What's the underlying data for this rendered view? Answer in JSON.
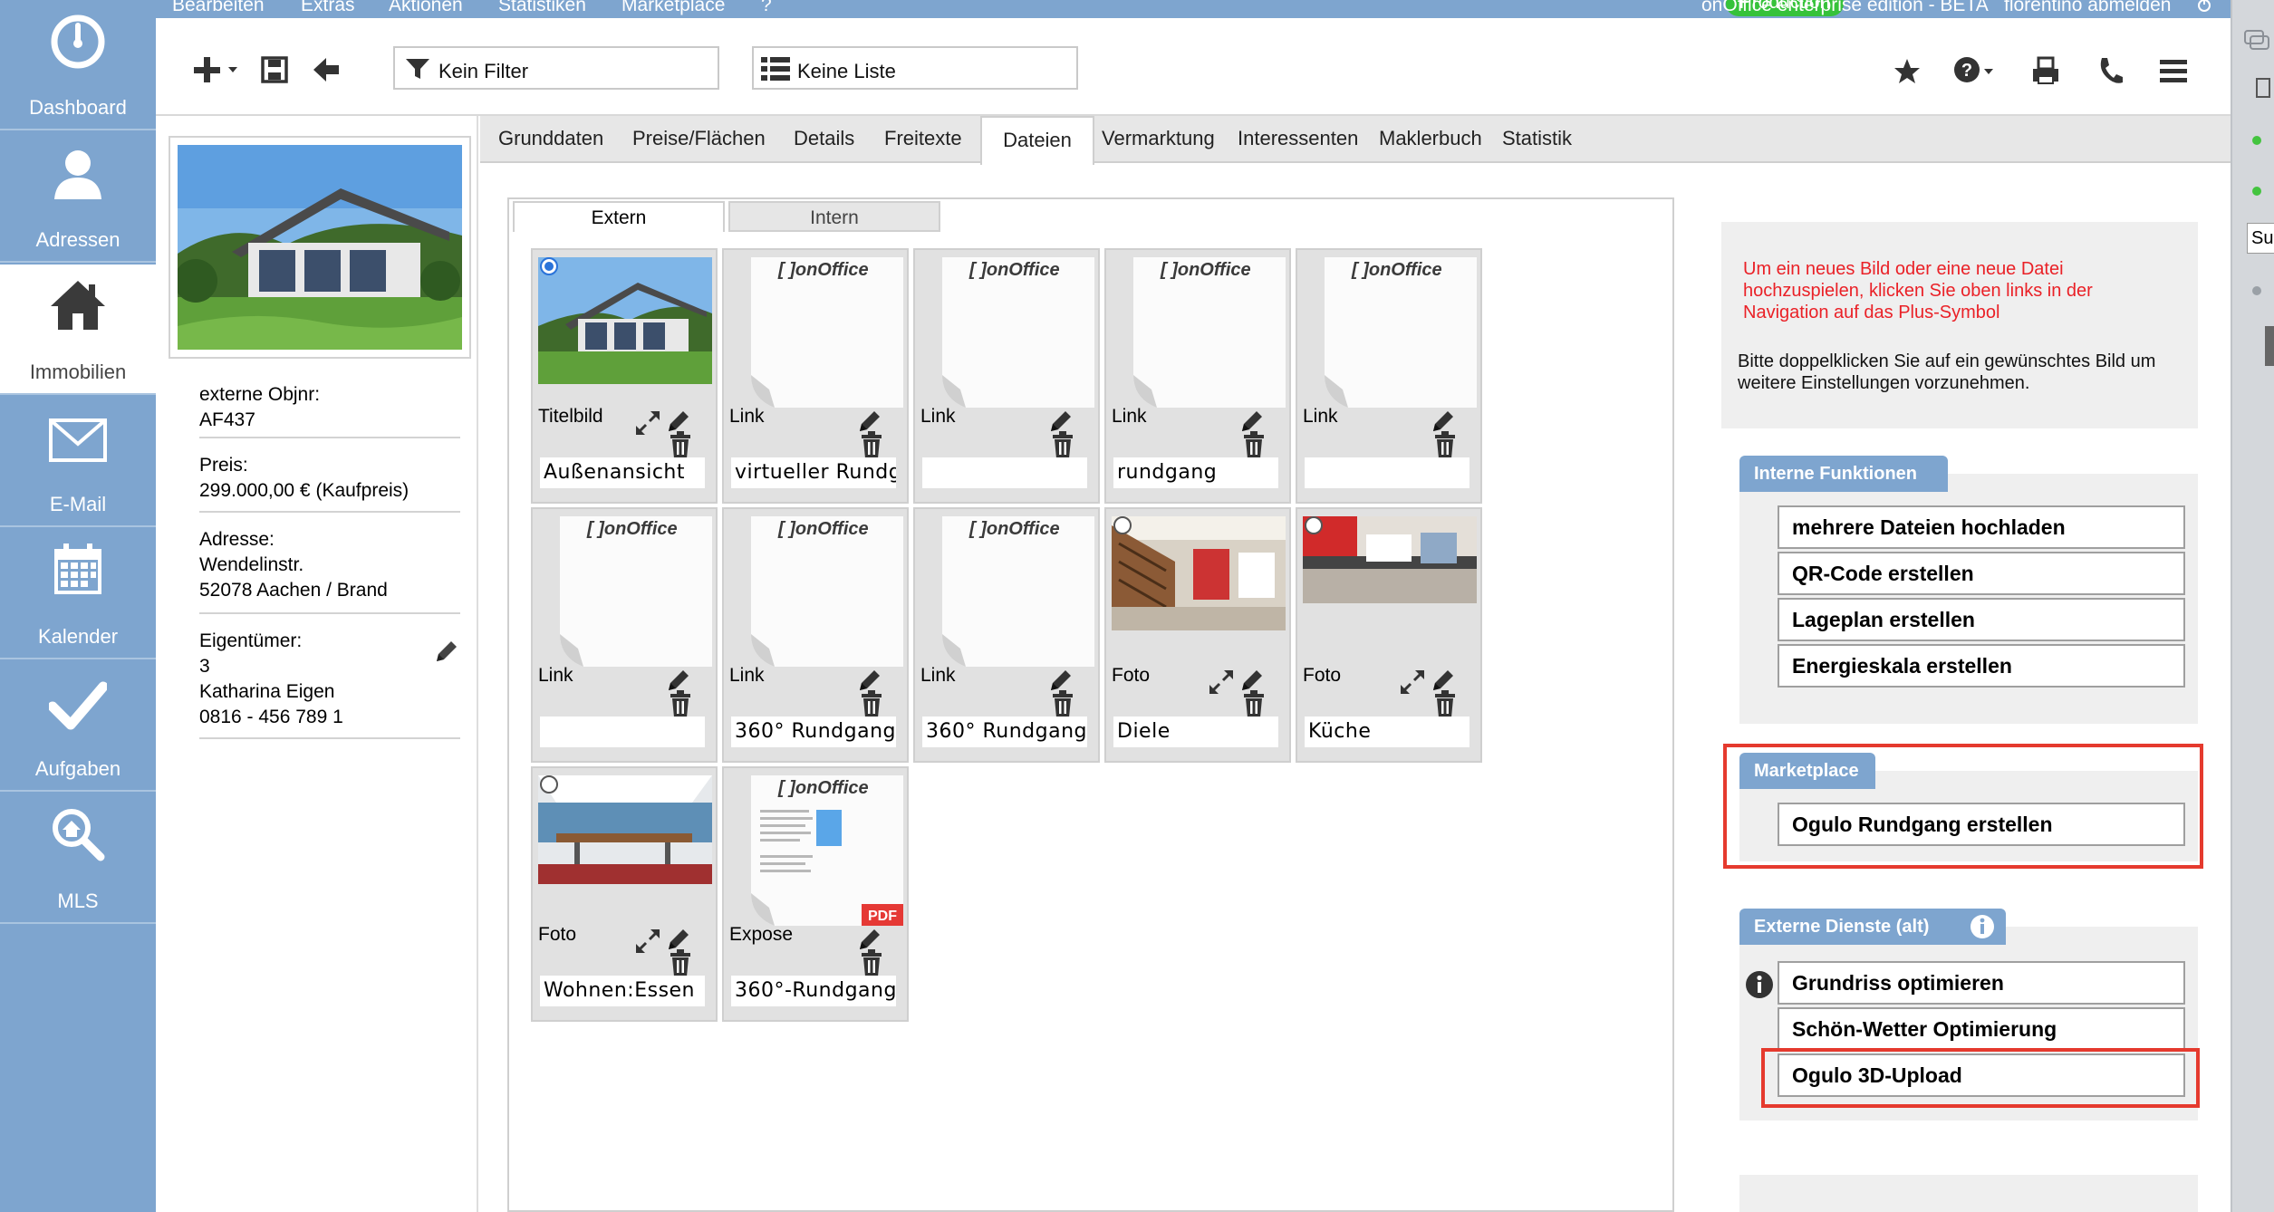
{
  "nav": [
    {
      "label": "Dashboard",
      "icon": "gauge-icon"
    },
    {
      "label": "Adressen",
      "icon": "person-icon"
    },
    {
      "label": "Immobilien",
      "icon": "house-icon",
      "active": true
    },
    {
      "label": "E-Mail",
      "icon": "envelope-icon"
    },
    {
      "label": "Kalender",
      "icon": "calendar-icon"
    },
    {
      "label": "Aufgaben",
      "icon": "check-icon"
    },
    {
      "label": "MLS",
      "icon": "magnifier-icon"
    }
  ],
  "menu": [
    "Bearbeiten",
    "Extras",
    "Aktionen",
    "Statistiken",
    "Marketplace",
    "?"
  ],
  "top": {
    "badge": "Production",
    "edition": "onOffice enterprise edition - BETA",
    "logout": "florentino abmelden"
  },
  "toolbar": {
    "filter": "Kein Filter",
    "list": "Keine Liste",
    "icons": [
      "plus-icon",
      "save-icon",
      "back-arrow-icon",
      "star-icon",
      "help-icon",
      "print-icon",
      "phone-icon",
      "menu-icon"
    ]
  },
  "property": {
    "objnr_label": "externe Objnr:",
    "objnr": "AF437",
    "price_label": "Preis:",
    "price": "299.000,00 € (Kaufpreis)",
    "address_label": "Adresse:",
    "street": "Wendelinstr.",
    "city": "52078 Aachen / Brand",
    "owner_label": "Eigentümer:",
    "owner_num": "3",
    "owner_name": "Katharina Eigen",
    "owner_phone": "0816 - 456 789 1"
  },
  "tabs": [
    "Grunddaten",
    "Preise/Flächen",
    "Details",
    "Freitexte",
    "Dateien",
    "Vermarktung",
    "Interessenten",
    "Maklerbuch",
    "Statistik"
  ],
  "active_tab": "Dateien",
  "subtabs": [
    "Extern",
    "Intern"
  ],
  "files": [
    {
      "type": "Titelbild",
      "caption": "Außenansicht",
      "kind": "house"
    },
    {
      "type": "Link",
      "caption": "virtueller Rundg",
      "kind": "doc"
    },
    {
      "type": "Link",
      "caption": "",
      "kind": "doc"
    },
    {
      "type": "Link",
      "caption": "rundgang",
      "kind": "doc"
    },
    {
      "type": "Link",
      "caption": "",
      "kind": "doc"
    },
    {
      "type": "Link",
      "caption": "",
      "kind": "doc"
    },
    {
      "type": "Link",
      "caption": "360° Rundgang",
      "kind": "doc"
    },
    {
      "type": "Link",
      "caption": "360° Rundgang",
      "kind": "doc"
    },
    {
      "type": "Foto",
      "caption": "Diele",
      "kind": "hall"
    },
    {
      "type": "Foto",
      "caption": "Küche",
      "kind": "kitchen"
    },
    {
      "type": "Foto",
      "caption": "Wohnen:Essen",
      "kind": "living"
    },
    {
      "type": "Expose",
      "caption": "360°-Rundgang",
      "kind": "pdf"
    }
  ],
  "doc_logo": "onOffice",
  "pdf_badge": "PDF",
  "info": {
    "red": "Um ein neues Bild oder eine neue Datei hochzuspielen, klicken Sie oben links in der Navigation auf das Plus-Symbol",
    "black": "Bitte doppelklicken Sie auf ein gewünschtes Bild um weitere Einstellungen vorzunehmen."
  },
  "groups": {
    "interne": {
      "title": "Interne Funktionen",
      "buttons": [
        "mehrere Dateien hochladen",
        "QR-Code erstellen",
        "Lageplan erstellen",
        "Energieskala erstellen"
      ]
    },
    "marketplace": {
      "title": "Marketplace",
      "buttons": [
        "Ogulo Rundgang erstellen"
      ]
    },
    "externe": {
      "title": "Externe Dienste (alt)",
      "buttons": [
        "Grundriss optimieren",
        "Schön-Wetter Optimierung",
        "Ogulo 3D-Upload"
      ]
    }
  },
  "far_right": {
    "input_text": "Su"
  },
  "colors": {
    "nav_blue": "#7ea5cf",
    "highlight_red": "#e53a2e",
    "info_red": "#ea2127",
    "badge_green": "#36c23a"
  }
}
